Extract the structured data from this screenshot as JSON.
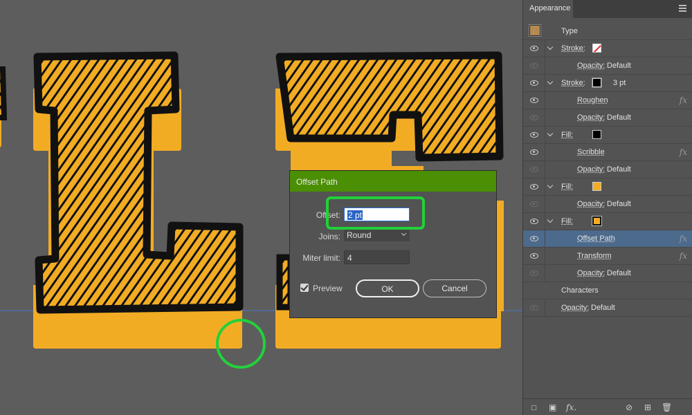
{
  "panel": {
    "tab_label": "Appearance",
    "rows": [
      {
        "kind": "type",
        "label": "Type"
      },
      {
        "kind": "attr",
        "eye": true,
        "chevron": true,
        "label": "Stroke:",
        "swatch": "none"
      },
      {
        "kind": "sub",
        "eye": false,
        "label": "Opacity:",
        "value": "Default"
      },
      {
        "kind": "attr",
        "eye": true,
        "chevron": true,
        "label": "Stroke:",
        "swatch": "black",
        "value": "3 pt"
      },
      {
        "kind": "sub",
        "eye": true,
        "label": "Roughen",
        "fx": true
      },
      {
        "kind": "sub",
        "eye": false,
        "label": "Opacity:",
        "value": "Default"
      },
      {
        "kind": "attr",
        "eye": true,
        "chevron": true,
        "label": "Fill:",
        "swatch": "black-plain"
      },
      {
        "kind": "sub",
        "eye": true,
        "label": "Scribble",
        "fx": true
      },
      {
        "kind": "sub",
        "eye": false,
        "label": "Opacity:",
        "value": "Default"
      },
      {
        "kind": "attr",
        "eye": true,
        "chevron": true,
        "label": "Fill:",
        "swatch": "orange"
      },
      {
        "kind": "sub",
        "eye": false,
        "label": "Opacity:",
        "value": "Default"
      },
      {
        "kind": "attr",
        "eye": true,
        "chevron": true,
        "label": "Fill:",
        "swatch": "orange-boxed"
      },
      {
        "kind": "sub",
        "eye": true,
        "label": "Offset Path",
        "fx": true,
        "selected": true
      },
      {
        "kind": "sub",
        "eye": true,
        "label": "Transform",
        "fx": true
      },
      {
        "kind": "sub",
        "eye": false,
        "label": "Opacity:",
        "value": "Default"
      },
      {
        "kind": "plain",
        "label": "Characters"
      },
      {
        "kind": "attr-noindent",
        "eye": false,
        "label": "Opacity:",
        "value": "Default"
      }
    ],
    "fx_symbol": "fx",
    "bottom_icons": [
      "new-stroke-icon",
      "new-fill-icon",
      "add-effect-icon",
      "clear-icon",
      "duplicate-icon",
      "delete-icon"
    ],
    "bottom_fx_label": "fx."
  },
  "dialog": {
    "title": "Offset Path",
    "offset_label": "Offset:",
    "offset_value": "2 pt",
    "joins_label": "Joins:",
    "joins_value": "Round",
    "miter_label": "Miter limit:",
    "miter_value": "4",
    "preview_label": "Preview",
    "preview_checked": true,
    "ok_label": "OK",
    "cancel_label": "Cancel"
  },
  "colors": {
    "accent_green": "#22d13a",
    "title_bar_green": "#4b8f04",
    "letter_orange": "#f2ac24",
    "selection_blue": "#4c6a8c"
  }
}
